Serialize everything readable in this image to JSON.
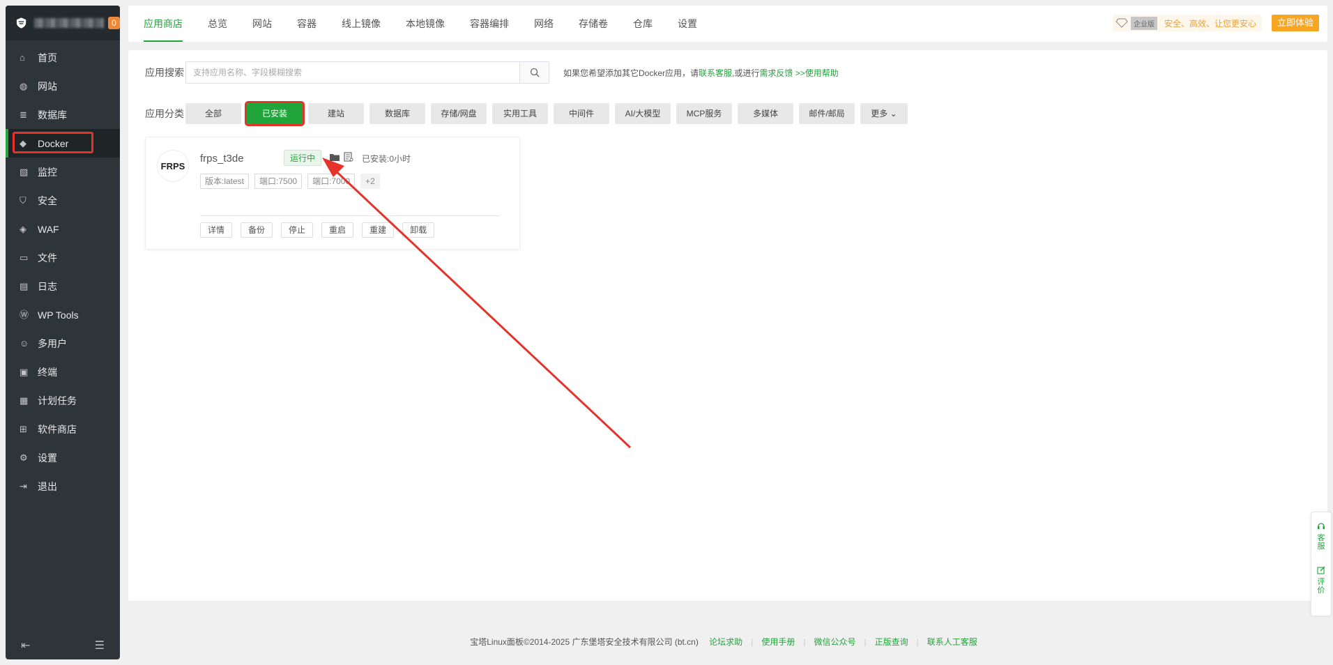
{
  "sidebar": {
    "badge": "0",
    "items": [
      {
        "label": "首页",
        "icon": "home-icon"
      },
      {
        "label": "网站",
        "icon": "globe-icon"
      },
      {
        "label": "数据库",
        "icon": "database-icon"
      },
      {
        "label": "Docker",
        "icon": "docker-icon"
      },
      {
        "label": "监控",
        "icon": "monitor-icon"
      },
      {
        "label": "安全",
        "icon": "shield-icon"
      },
      {
        "label": "WAF",
        "icon": "waf-icon"
      },
      {
        "label": "文件",
        "icon": "folder-icon"
      },
      {
        "label": "日志",
        "icon": "log-icon"
      },
      {
        "label": "WP Tools",
        "icon": "wordpress-icon"
      },
      {
        "label": "多用户",
        "icon": "users-icon"
      },
      {
        "label": "终端",
        "icon": "terminal-icon"
      },
      {
        "label": "计划任务",
        "icon": "calendar-icon"
      },
      {
        "label": "软件商店",
        "icon": "apps-icon"
      },
      {
        "label": "设置",
        "icon": "gear-icon"
      },
      {
        "label": "退出",
        "icon": "logout-icon"
      }
    ]
  },
  "topnav": {
    "tabs": [
      "应用商店",
      "总览",
      "网站",
      "容器",
      "线上镜像",
      "本地镜像",
      "容器编排",
      "网络",
      "存储卷",
      "仓库",
      "设置"
    ],
    "enterprise_badge": "企业版",
    "promo_text": "安全、高效、让您更安心",
    "try_button": "立即体验"
  },
  "search": {
    "label": "应用搜索",
    "placeholder": "支持应用名称、字段模糊搜索",
    "hint_prefix": "如果您希望添加其它Docker应用，请",
    "hint_link1": "联系客服",
    "hint_mid": ",或进行",
    "hint_link2": "需求反馈",
    "hint_link3": ">>使用帮助"
  },
  "categories": {
    "label": "应用分类",
    "items": [
      "全部",
      "已安装",
      "建站",
      "数据库",
      "存储/网盘",
      "实用工具",
      "中间件",
      "AI/大模型",
      "MCP服务",
      "多媒体",
      "邮件/邮局",
      "更多"
    ]
  },
  "app": {
    "logo_text": "FRPS",
    "name": "frps_t3de",
    "status": "运行中",
    "installed": "已安装:0小时",
    "tags": [
      "版本:latest",
      "端口:7500",
      "端口:7000",
      "+2"
    ],
    "actions": [
      "详情",
      "备份",
      "停止",
      "重启",
      "重建",
      "卸载"
    ]
  },
  "footer": {
    "copyright": "宝塔Linux面板©2014-2025 广东堡塔安全技术有限公司 (bt.cn)",
    "links": [
      "论坛求助",
      "使用手册",
      "微信公众号",
      "正版查询",
      "联系人工客服"
    ]
  },
  "float": {
    "service": "客服",
    "review": "评价"
  },
  "colors": {
    "accent": "#20a53a",
    "highlight": "#e5332a",
    "promo": "#f7a623"
  }
}
